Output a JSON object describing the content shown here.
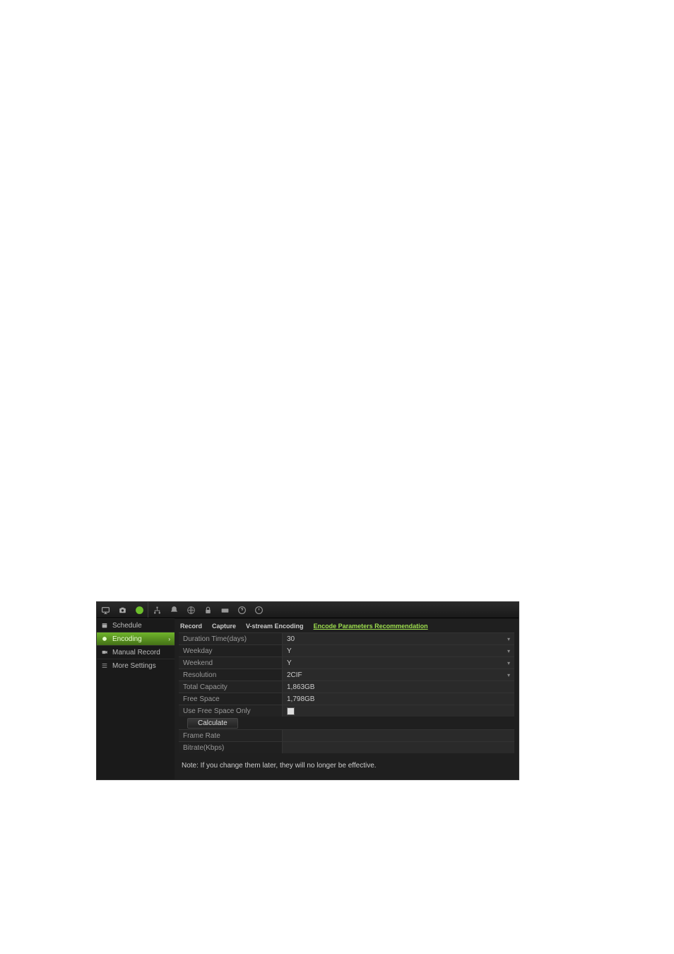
{
  "sidebar": {
    "items": [
      {
        "label": "Schedule"
      },
      {
        "label": "Encoding"
      },
      {
        "label": "Manual Record"
      },
      {
        "label": "More Settings"
      }
    ]
  },
  "tabs": {
    "items": [
      {
        "label": "Record"
      },
      {
        "label": "Capture"
      },
      {
        "label": "V-stream Encoding"
      },
      {
        "label": "Encode Parameters Recommendation"
      }
    ]
  },
  "form": {
    "duration_label": "Duration Time(days)",
    "duration_value": "30",
    "weekday_label": "Weekday",
    "weekday_value": "Y",
    "weekend_label": "Weekend",
    "weekend_value": "Y",
    "resolution_label": "Resolution",
    "resolution_value": "2CIF",
    "total_cap_label": "Total Capacity",
    "total_cap_value": "1,863GB",
    "free_space_label": "Free Space",
    "free_space_value": "1,798GB",
    "use_free_label": "Use Free Space Only",
    "calculate_btn": "Calculate",
    "frame_rate_label": "Frame Rate",
    "frame_rate_value": "",
    "bitrate_label": "Bitrate(Kbps)",
    "bitrate_value": ""
  },
  "note": "Note: If you change them later, they will no longer be effective."
}
